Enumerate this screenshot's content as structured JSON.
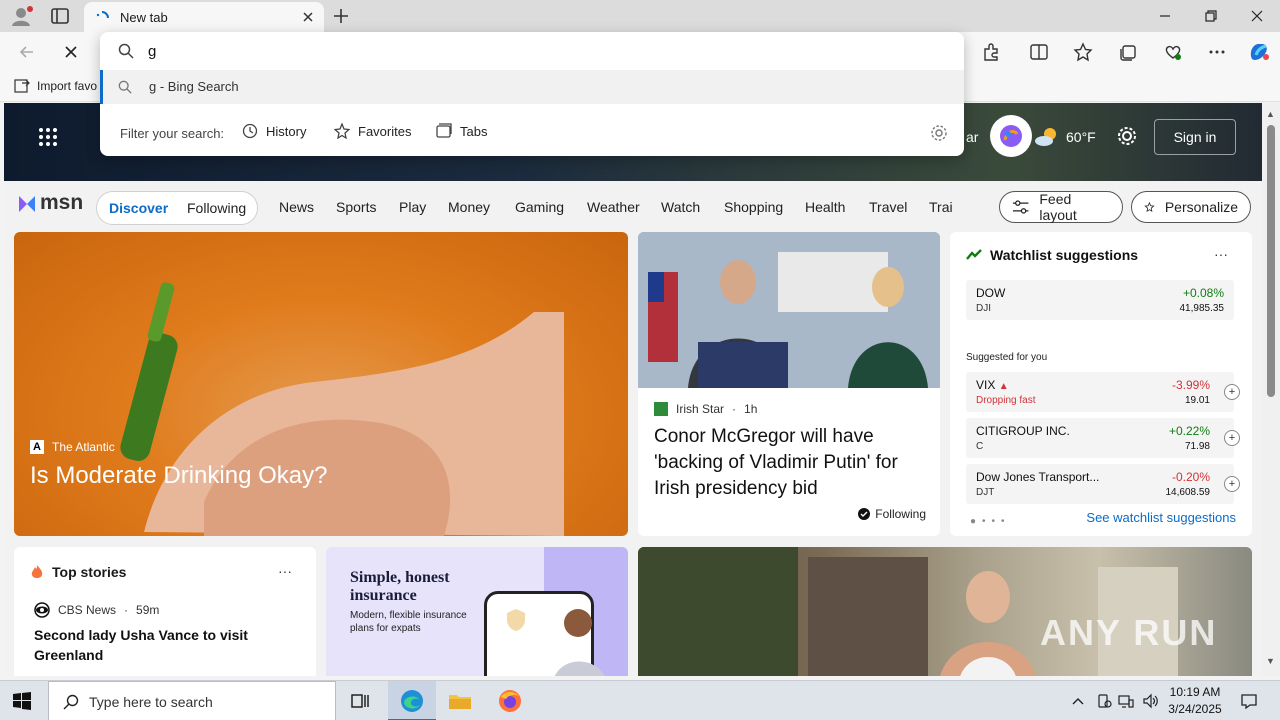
{
  "tab": {
    "title": "New tab"
  },
  "favorites_bar": {
    "import_label": "Import favo"
  },
  "omnibox": {
    "value": "g",
    "suggestion": "g - Bing Search",
    "filter_label": "Filter your search:",
    "filters": [
      "History",
      "Favorites",
      "Tabs"
    ]
  },
  "hero": {
    "partial_text": "ar",
    "temperature": "60°F",
    "signin": "Sign in"
  },
  "msn": {
    "logo": "msn",
    "primary_tabs": [
      "Discover",
      "Following"
    ],
    "nav": [
      "News",
      "Sports",
      "Play",
      "Money",
      "Gaming",
      "Weather",
      "Watch",
      "Shopping",
      "Health",
      "Travel",
      "Trai"
    ],
    "feed_layout": "Feed layout",
    "personalize": "Personalize"
  },
  "cards": {
    "big": {
      "source": "The Atlantic",
      "title": "Is Moderate Drinking Okay?"
    },
    "news": {
      "source": "Irish Star",
      "time": "1h",
      "headline": "Conor McGregor will have 'backing of Vladimir Putin' for Irish presidency bid",
      "following": "Following"
    },
    "watchlist": {
      "title": "Watchlist suggestions",
      "more": "···",
      "suggested_label": "Suggested for you",
      "see_all": "See watchlist suggestions",
      "stocks": [
        {
          "name": "DOW",
          "symbol": "DJI",
          "change": "+0.08%",
          "price": "41,985.35",
          "color": "#107c10"
        },
        {
          "name": "VIX",
          "symbol": "Dropping fast",
          "change": "-3.99%",
          "price": "19.01",
          "color": "#d13438"
        },
        {
          "name": "CITIGROUP INC.",
          "symbol": "C",
          "change": "+0.22%",
          "price": "71.98",
          "color": "#107c10"
        },
        {
          "name": "Dow Jones Transport...",
          "symbol": "DJT",
          "change": "-0.20%",
          "price": "14,608.59",
          "color": "#d13438"
        }
      ]
    },
    "top_stories": {
      "title": "Top stories",
      "more": "···",
      "source": "CBS News",
      "time": "59m",
      "headline": "Second lady Usha Vance to visit Greenland"
    },
    "ad": {
      "title": "Simple, honest insurance",
      "subtitle": "Modern, flexible insurance plans for expats"
    }
  },
  "watermark": "ANY RUN",
  "taskbar": {
    "search_placeholder": "Type here to search",
    "time": "10:19 AM",
    "date": "3/24/2025"
  },
  "colors": {
    "accent": "#0b6cc9",
    "positive": "#107c10",
    "negative": "#d13438"
  }
}
